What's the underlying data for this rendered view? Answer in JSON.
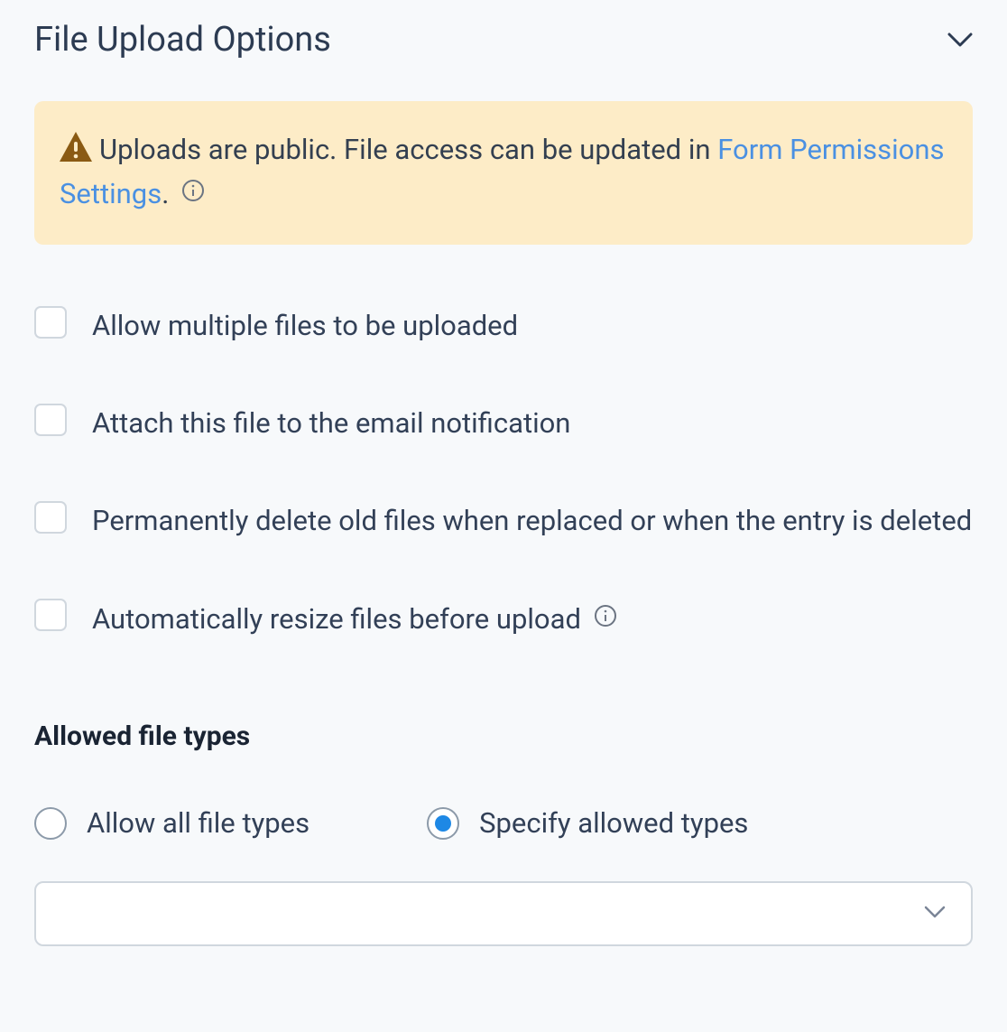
{
  "section": {
    "title": "File Upload Options"
  },
  "alert": {
    "text_prefix": "Uploads are public. File access can be updated in ",
    "link_text": "Form Permissions Settings",
    "text_suffix": "."
  },
  "options": [
    {
      "label": "Allow multiple files to be uploaded",
      "checked": false
    },
    {
      "label": "Attach this file to the email notification",
      "checked": false
    },
    {
      "label": "Permanently delete old files when replaced or when the entry is deleted",
      "checked": false
    },
    {
      "label": "Automatically resize files before upload",
      "checked": false,
      "has_info": true
    }
  ],
  "allowed_types": {
    "heading": "Allowed file types",
    "radios": [
      {
        "label": "Allow all file types",
        "value": "all",
        "selected": false
      },
      {
        "label": "Specify allowed types",
        "value": "specify",
        "selected": true
      }
    ],
    "select_value": ""
  }
}
